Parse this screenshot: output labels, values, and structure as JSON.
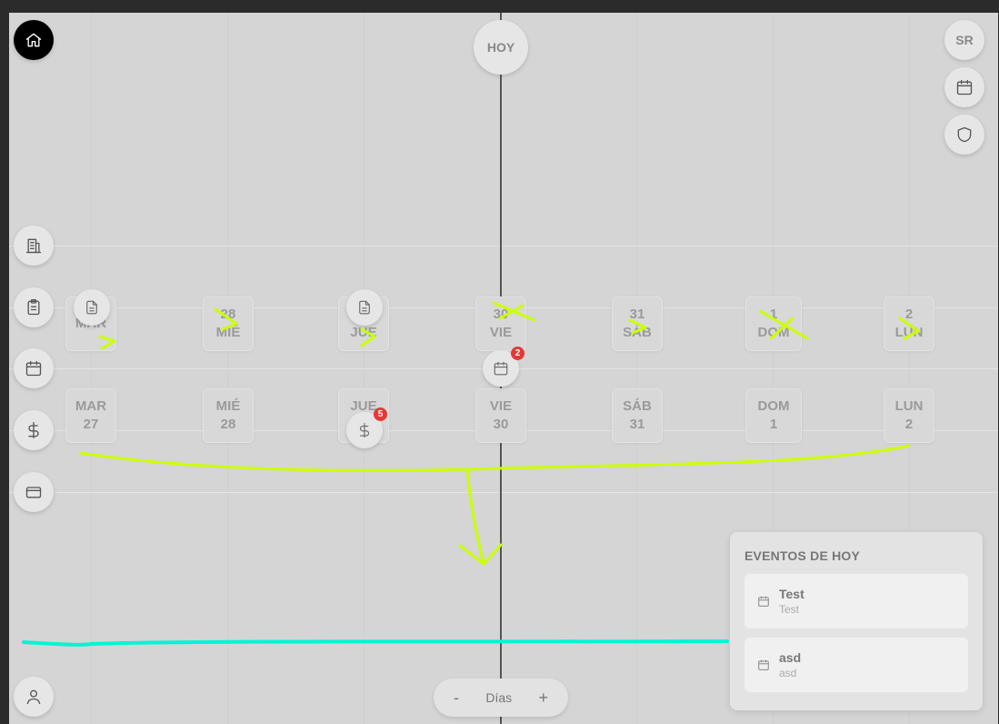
{
  "header": {
    "today_label": "HOY",
    "user_initials": "SR"
  },
  "top_row_days": [
    {
      "dow": "MAR",
      "day": ""
    },
    {
      "dow": "MIÉ",
      "day": "28"
    },
    {
      "dow": "JUE",
      "day": ""
    },
    {
      "dow": "VIE",
      "day": "30"
    },
    {
      "dow": "SÁB",
      "day": "31"
    },
    {
      "dow": "DOM",
      "day": "1"
    },
    {
      "dow": "LUN",
      "day": "2"
    }
  ],
  "bottom_row_days": [
    {
      "dow": "MAR",
      "day": "27"
    },
    {
      "dow": "MIÉ",
      "day": "28"
    },
    {
      "dow": "JUE",
      "day": ""
    },
    {
      "dow": "VIE",
      "day": "30"
    },
    {
      "dow": "SÁB",
      "day": "31"
    },
    {
      "dow": "DOM",
      "day": "1"
    },
    {
      "dow": "LUN",
      "day": "2"
    }
  ],
  "badges": {
    "calendar_count": "2",
    "payments_count": "5"
  },
  "zoom": {
    "minus": "-",
    "label": "Días",
    "plus": "+"
  },
  "events": {
    "title": "EVENTOS DE HOY",
    "items": [
      {
        "title": "Test",
        "subtitle": "Test"
      },
      {
        "title": "asd",
        "subtitle": "asd"
      }
    ]
  },
  "colors": {
    "annotation_yellow": "#ccff00",
    "annotation_cyan": "#00f5d4",
    "badge_red": "#e53935"
  }
}
